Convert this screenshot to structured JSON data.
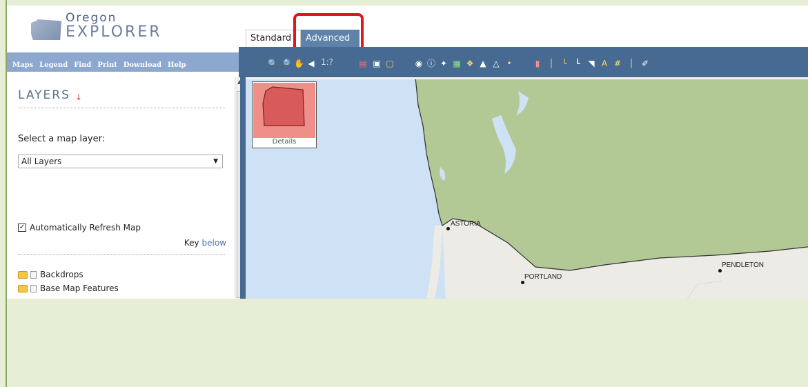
{
  "header": {
    "logo_line1": "Oregon",
    "logo_line2": "EXPLORER",
    "tabs": [
      {
        "label": "Standard"
      },
      {
        "label": "Advanced"
      }
    ]
  },
  "navbar": {
    "items": [
      "Maps",
      "Legend",
      "Find",
      "Print",
      "Download",
      "Help"
    ]
  },
  "toolbar": {
    "scale_label": "1:?",
    "icons": [
      "zoom-in-icon",
      "zoom-out-icon",
      "pan-hand-icon",
      "back-arrow-icon",
      "pdf-icon",
      "save-icon",
      "open-folder-icon",
      "identify-icon",
      "info-icon",
      "query-icon",
      "select-icon",
      "buffer-icon",
      "area-icon",
      "measure-icon",
      "pin-icon",
      "draw-icon",
      "point-icon",
      "line-icon",
      "polygon-icon",
      "text-icon",
      "label-icon",
      "grid-icon",
      "marker-icon",
      "eraser-icon"
    ]
  },
  "sidebar": {
    "title": "LAYERS",
    "select_label": "Select a map layer:",
    "select_value": "All Layers",
    "auto_refresh_label": "Automatically Refresh Map",
    "auto_refresh_checked": true,
    "key_text": "Key",
    "key_link": "below",
    "tree": [
      {
        "label": "Backdrops"
      },
      {
        "label": "Base Map Features"
      }
    ]
  },
  "map": {
    "details_label": "Details",
    "cities": [
      {
        "name": "ASTORIA"
      },
      {
        "name": "PORTLAND"
      },
      {
        "name": "PENDLETON"
      }
    ],
    "colors": {
      "water": "#cfe1f5",
      "land": "#b3c995",
      "oregon_land": "#ecebe6",
      "border": "#2e2e2e"
    }
  }
}
